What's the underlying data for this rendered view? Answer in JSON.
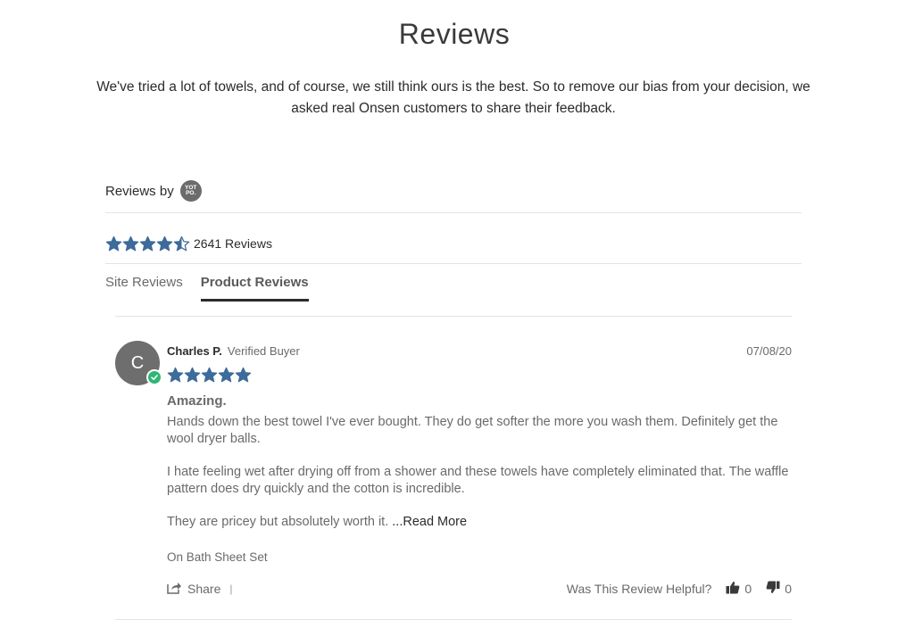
{
  "header": {
    "title": "Reviews",
    "intro": "We've tried a lot of towels, and of course, we still think ours is the best. So to remove our bias from your decision, we asked real Onsen customers to share their feedback."
  },
  "widget": {
    "reviews_by_label": "Reviews by",
    "logo_text": "YOT PO.",
    "rating": 4.5,
    "review_count_label": "2641 Reviews",
    "star_color": "#3d6b9a"
  },
  "tabs": [
    {
      "label": "Site Reviews",
      "active": false
    },
    {
      "label": "Product Reviews",
      "active": true
    }
  ],
  "review": {
    "avatar_initial": "C",
    "name": "Charles P.",
    "badge": "Verified Buyer",
    "date": "07/08/20",
    "rating": 5,
    "title": "Amazing.",
    "paragraphs": [
      "Hands down the best towel I've ever bought. They do get softer the more you wash them. Definitely get the wool dryer balls.",
      "I hate feeling wet after drying off from a shower and these towels have completely eliminated that. The waffle pattern does dry quickly and the cotton is incredible.",
      "They are pricey but absolutely worth it."
    ],
    "read_more_label": "...Read More",
    "product": "On Bath Sheet Set",
    "share_label": "Share",
    "share_separator": "|",
    "helpful_label": "Was This Review Helpful?",
    "votes_up": "0",
    "votes_down": "0"
  }
}
